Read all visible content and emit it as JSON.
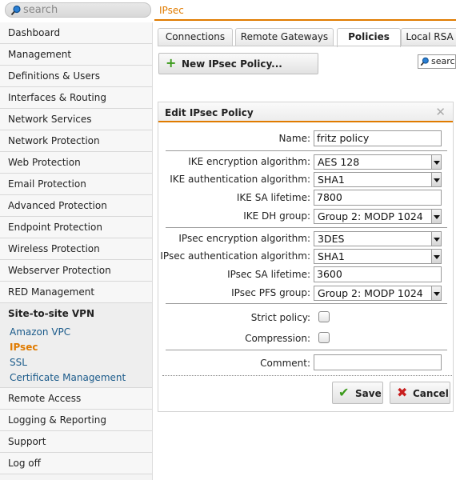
{
  "search": {
    "placeholder": "search"
  },
  "breadcrumb": "IPsec",
  "colors": {
    "accent": "#e07b00",
    "link": "#1a5a8a",
    "save_icon": "#3a9a1a",
    "cancel_icon": "#c81e1e"
  },
  "sidebar": {
    "items_top": [
      "Dashboard",
      "Management",
      "Definitions & Users",
      "Interfaces & Routing",
      "Network Services",
      "Network Protection",
      "Web Protection",
      "Email Protection",
      "Advanced Protection",
      "Endpoint Protection",
      "Wireless Protection",
      "Webserver Protection",
      "RED Management"
    ],
    "section": {
      "title": "Site-to-site VPN",
      "subitems": [
        "Amazon VPC",
        "IPsec",
        "SSL",
        "Certificate Management"
      ],
      "active": "IPsec"
    },
    "items_bottom": [
      "Remote Access",
      "Logging & Reporting",
      "Support",
      "Log off"
    ]
  },
  "tabs": [
    "Connections",
    "Remote Gateways",
    "Policies",
    "Local RSA"
  ],
  "active_tab": "Policies",
  "new_policy_label": "New IPsec Policy...",
  "mini_search_text": "search",
  "panel": {
    "title": "Edit IPsec Policy",
    "close_icon": "close-icon",
    "name": {
      "label": "Name:",
      "value": "fritz policy"
    },
    "ike_enc": {
      "label": "IKE encryption algorithm:",
      "value": "AES 128"
    },
    "ike_auth": {
      "label": "IKE authentication algorithm:",
      "value": "SHA1"
    },
    "ike_lifetime": {
      "label": "IKE SA lifetime:",
      "value": "7800"
    },
    "ike_dh": {
      "label": "IKE DH group:",
      "value": "Group 2: MODP 1024"
    },
    "ipsec_enc": {
      "label": "IPsec encryption algorithm:",
      "value": "3DES"
    },
    "ipsec_auth": {
      "label": "IPsec authentication algorithm:",
      "value": "SHA1"
    },
    "ipsec_lifetime": {
      "label": "IPsec SA lifetime:",
      "value": "3600"
    },
    "ipsec_pfs": {
      "label": "IPsec PFS group:",
      "value": "Group 2: MODP 1024"
    },
    "strict": {
      "label": "Strict policy:",
      "checked": false
    },
    "compression": {
      "label": "Compression:",
      "checked": false
    },
    "comment": {
      "label": "Comment:",
      "value": ""
    },
    "save_label": "Save",
    "cancel_label": "Cancel"
  }
}
